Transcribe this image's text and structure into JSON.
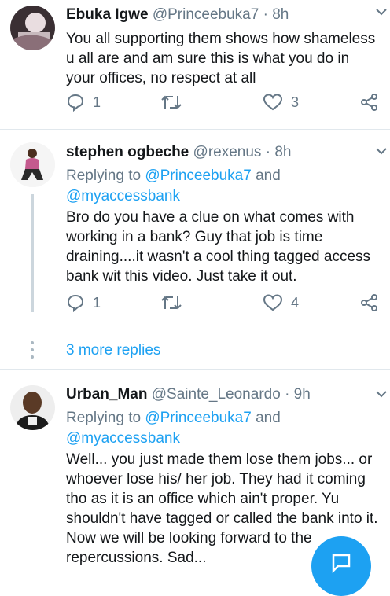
{
  "tweets": [
    {
      "name": "Ebuka Igwe",
      "handle": "@Princeebuka7",
      "time": "8h",
      "text": "You all supporting them shows how shameless u all are and am sure this is what you do in your offices, no respect at all",
      "reply_count": "1",
      "retweet_count": "",
      "like_count": "3"
    },
    {
      "name": "stephen ogbeche",
      "handle": "@rexenus",
      "time": "8h",
      "replying_prefix": "Replying to ",
      "replying_user1": "@Princeebuka7",
      "replying_and": " and",
      "replying_user2": "@myaccessbank",
      "text": "Bro do you have a clue on what comes with working in a bank? Guy that job is time draining....it wasn't a cool thing tagged access bank wit this video. Just take it out.",
      "reply_count": "1",
      "retweet_count": "",
      "like_count": "4"
    },
    {
      "name": "Urban_Man",
      "handle": "@Sainte_Leonardo",
      "time": "9h",
      "replying_prefix": "Replying to ",
      "replying_user1": "@Princeebuka7",
      "replying_and": " and",
      "replying_user2": "@myaccessbank",
      "text": "Well... you just made them lose them jobs... or whoever lose his/ her job. They had it coming tho as it is an office which ain't proper. Yu shouldn't have tagged or called the bank into it. Now we will be looking forward to the repercussions. Sad..."
    }
  ],
  "more_replies": "3 more replies",
  "separator": "·",
  "colors": {
    "link": "#1da1f2",
    "secondary": "#657786",
    "divider": "#e1e8ed"
  },
  "icons": [
    "reply-icon",
    "retweet-icon",
    "like-icon",
    "share-icon",
    "caret-down-icon",
    "compose-icon"
  ]
}
